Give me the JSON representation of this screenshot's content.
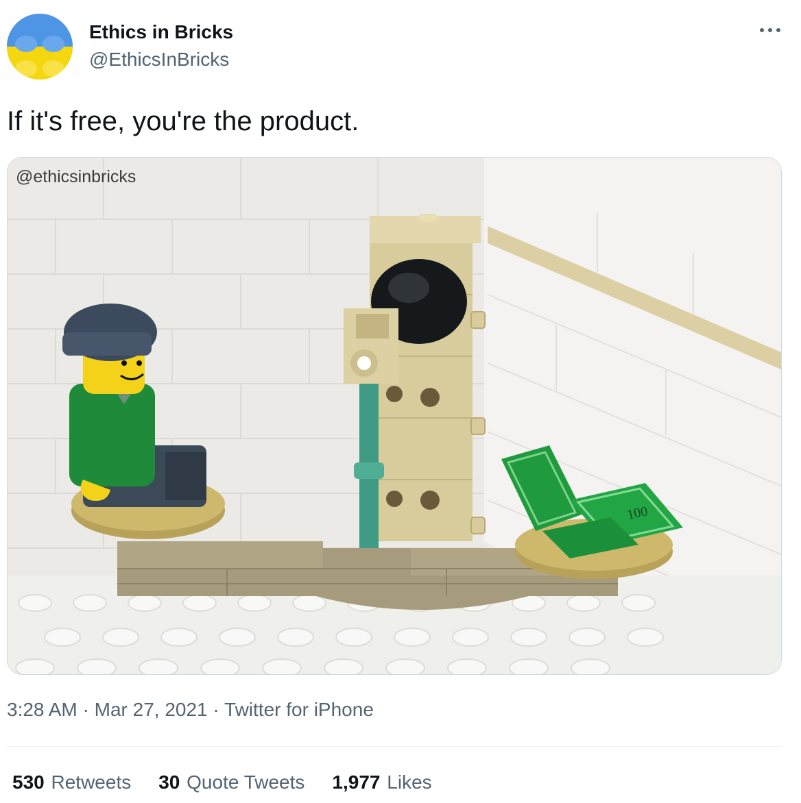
{
  "author": {
    "display_name": "Ethics in Bricks",
    "handle": "@EthicsInBricks",
    "avatar_icon": "lego-brick-avatar",
    "avatar_colors": [
      "#4a90e2",
      "#f5d90a"
    ]
  },
  "tweet": {
    "text": "If it's free, you're the product.",
    "more_icon": "more-horizontal-icon"
  },
  "media": {
    "watermark": "@ethicsinbricks",
    "bill_label": "100"
  },
  "meta": {
    "time": "3:28 AM",
    "separator": "·",
    "date": "Mar 27, 2021",
    "source": "Twitter for iPhone"
  },
  "stats": {
    "retweets": {
      "count": "530",
      "label": "Retweets"
    },
    "quote_tweets": {
      "count": "30",
      "label": "Quote Tweets"
    },
    "likes": {
      "count": "1,977",
      "label": "Likes"
    }
  },
  "colors": {
    "text_primary": "#0f1419",
    "text_secondary": "#536471",
    "border": "#cfd9de",
    "divider": "#eff3f4"
  }
}
